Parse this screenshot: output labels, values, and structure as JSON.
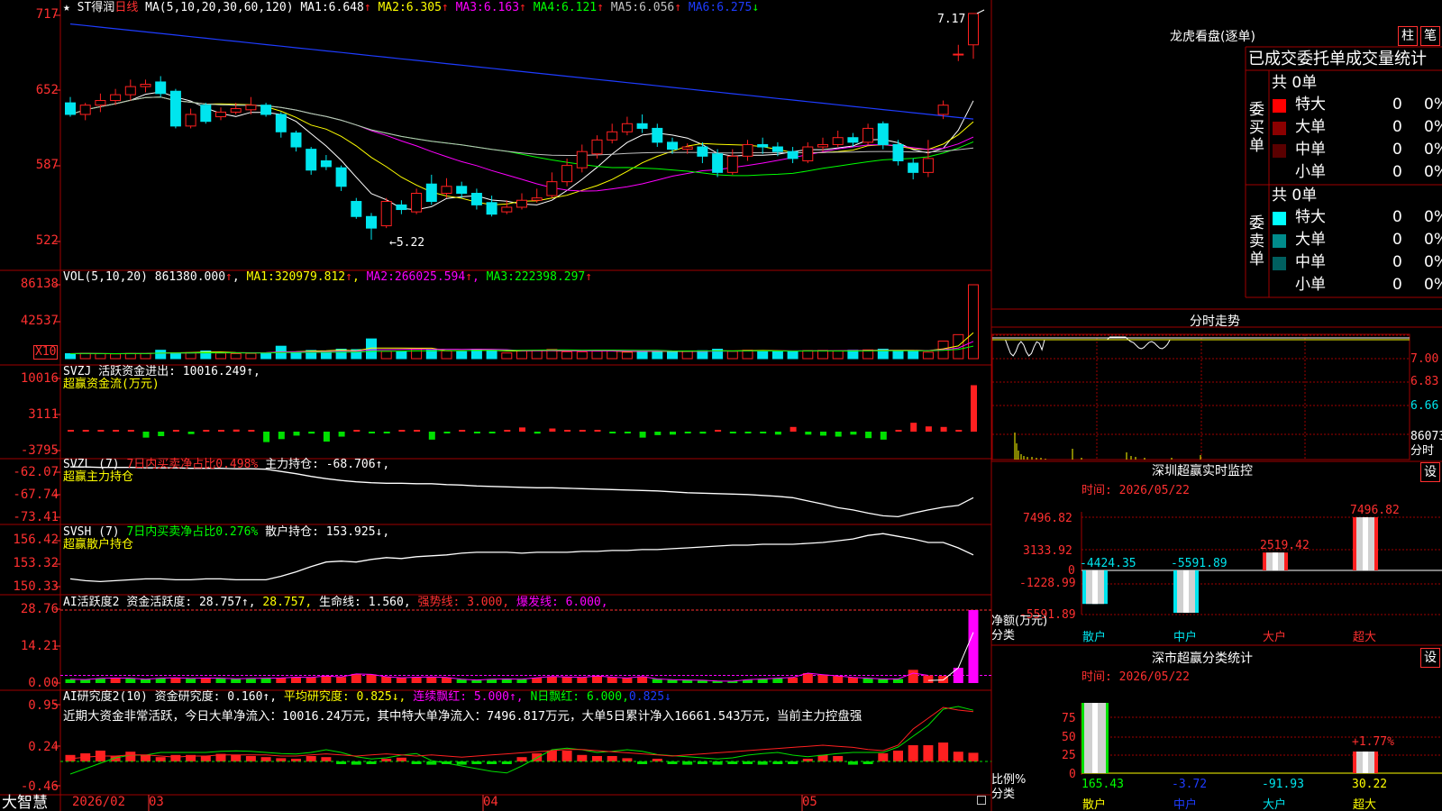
{
  "app": {
    "name": "大智慧"
  },
  "colors": {
    "up": "#ff2020",
    "down": "#00e5ee",
    "grid": "#a00000",
    "ma1": "#ffffff",
    "ma2": "#ffff00",
    "ma3": "#ff00ff",
    "ma4": "#00ff00",
    "ma5": "#c0c0c0",
    "ma6": "#1e3cff"
  },
  "price_panel": {
    "header": {
      "star": "★",
      "name": "ST得润",
      "period": "日线",
      "ma_def": "MA(5,10,20,30,60,120)",
      "ma": [
        {
          "label": "MA1:",
          "value": "6.648",
          "arrow": "↑"
        },
        {
          "label": "MA2:",
          "value": "6.305",
          "arrow": "↑"
        },
        {
          "label": "MA3:",
          "value": "6.163",
          "arrow": "↑"
        },
        {
          "label": "MA4:",
          "value": "6.121",
          "arrow": "↑"
        },
        {
          "label": "MA5:",
          "value": "6.056",
          "arrow": "↑"
        },
        {
          "label": "MA6:",
          "value": "6.275",
          "arrow": "↓"
        }
      ]
    },
    "y_labels": [
      "717",
      "652",
      "587",
      "522"
    ],
    "high_annotation": "7.17",
    "low_annotation": "←5.22"
  },
  "vol_panel": {
    "header": {
      "label": "VOL(5,10,20)",
      "value": "861380.000",
      "arrow": "↑",
      "ma": [
        {
          "label": "MA1:",
          "value": "320979.812",
          "arrow": "↑"
        },
        {
          "label": "MA2:",
          "value": "266025.594",
          "arrow": "↑"
        },
        {
          "label": "MA3:",
          "value": "222398.297",
          "arrow": "↑"
        }
      ]
    },
    "y_labels": [
      "86138",
      "42537"
    ],
    "unit": "X10"
  },
  "svzj_panel": {
    "line1": "SVZJ  活跃资金进出: 10016.249↑,",
    "line2": "超赢资金流(万元)",
    "y_labels": [
      "10016",
      "3111",
      "-3795"
    ]
  },
  "svzl_panel": {
    "title": "SVZL (7)",
    "ratio": "7日内买卖净占比0.498%",
    "holding": "主力持仓: -68.706↑,",
    "line2": "超赢主力持仓",
    "y_labels": [
      "-62.07",
      "-67.74",
      "-73.41"
    ]
  },
  "svsh_panel": {
    "title": "SVSH (7)",
    "ratio": "7日内买卖净占比0.276%",
    "holding": "散户持仓: 153.925↓,",
    "line2": "超赢散户持仓",
    "y_labels": [
      "156.42",
      "153.32",
      "150.33"
    ]
  },
  "ai_activity": {
    "title": "AI活跃度2",
    "act_label": "资金活跃度: 28.757↑,",
    "act2": "28.757,",
    "life": "生命线: 1.560,",
    "strong": "强势线: 3.000,",
    "burst": "爆发线: 6.000,",
    "y_labels": [
      "28.76",
      "14.21",
      "0.00"
    ]
  },
  "ai_research": {
    "title": "AI研究度2(10)",
    "research": "资金研究度: 0.160↑,",
    "avg": "平均研究度: 0.825↓,",
    "streak": "连续飘红: 5.000↑,",
    "nday": "N日飘红: 6.000,",
    "extra": "0.825↓",
    "comment": "近期大资金非常活跃，今日大单净流入：10016.24万元，其中特大单净流入：7496.817万元，大单5日累计净入16661.543万元，当前主力控盘强",
    "y_labels": [
      "0.95",
      "0.24",
      "-0.46"
    ]
  },
  "x_axis": {
    "labels": [
      "2026/02",
      "03",
      "04",
      "05"
    ]
  },
  "right": {
    "dragon": {
      "title": "龙虎看盘(逐单)",
      "btn_bar": "柱",
      "btn_stroke": "笔",
      "sub_title": "已成交委托单成交量统计",
      "buy": {
        "side": "委买单",
        "total": "共 0单",
        "rows": [
          {
            "label": "特大",
            "val": "0",
            "pct": "0%"
          },
          {
            "label": "大单",
            "val": "0",
            "pct": "0%"
          },
          {
            "label": "中单",
            "val": "0",
            "pct": "0%"
          },
          {
            "label": "小单",
            "val": "0",
            "pct": "0%"
          }
        ]
      },
      "sell": {
        "side": "委卖单",
        "total": "共 0单",
        "rows": [
          {
            "label": "特大",
            "val": "0",
            "pct": "0%"
          },
          {
            "label": "大单",
            "val": "0",
            "pct": "0%"
          },
          {
            "label": "中单",
            "val": "0",
            "pct": "0%"
          },
          {
            "label": "小单",
            "val": "0",
            "pct": "0%"
          }
        ]
      }
    },
    "intraday": {
      "title": "分时走势",
      "labels": [
        "7.00",
        "6.83",
        "6.66",
        "86073",
        "分时"
      ]
    },
    "sz_monitor": {
      "title": "深圳超赢实时监控",
      "set": "设",
      "date": "时间: 2026/05/22",
      "y_labels": [
        "7496.82",
        "3133.92",
        "0",
        "-1228.99",
        "-5591.89"
      ],
      "bars": [
        {
          "cat": "散户",
          "value": -4424.35,
          "label": "-4424.35"
        },
        {
          "cat": "中户",
          "value": -5591.89,
          "label": "-5591.89"
        },
        {
          "cat": "大户",
          "value": 2519.42,
          "label": "2519.42"
        },
        {
          "cat": "超大",
          "value": 7496.82,
          "label": "7496.82"
        }
      ],
      "ylabel": "净额(万元)",
      "xlabel": "分类"
    },
    "sz_class": {
      "title": "深市超赢分类统计",
      "set": "设",
      "date": "时间: 2026/05/22",
      "y_labels": [
        "75",
        "50",
        "25",
        "0"
      ],
      "bars": [
        {
          "cat": "散户",
          "value": 165.43,
          "label": "165.43"
        },
        {
          "cat": "中户",
          "value": -3.72,
          "label": "-3.72"
        },
        {
          "cat": "大户",
          "value": -91.93,
          "label": "-91.93"
        },
        {
          "cat": "超大",
          "value": 30.22,
          "label": "30.22"
        }
      ],
      "top_label": "+1.77%",
      "ylabel": "比例%",
      "xlabel": "分类"
    }
  }
}
